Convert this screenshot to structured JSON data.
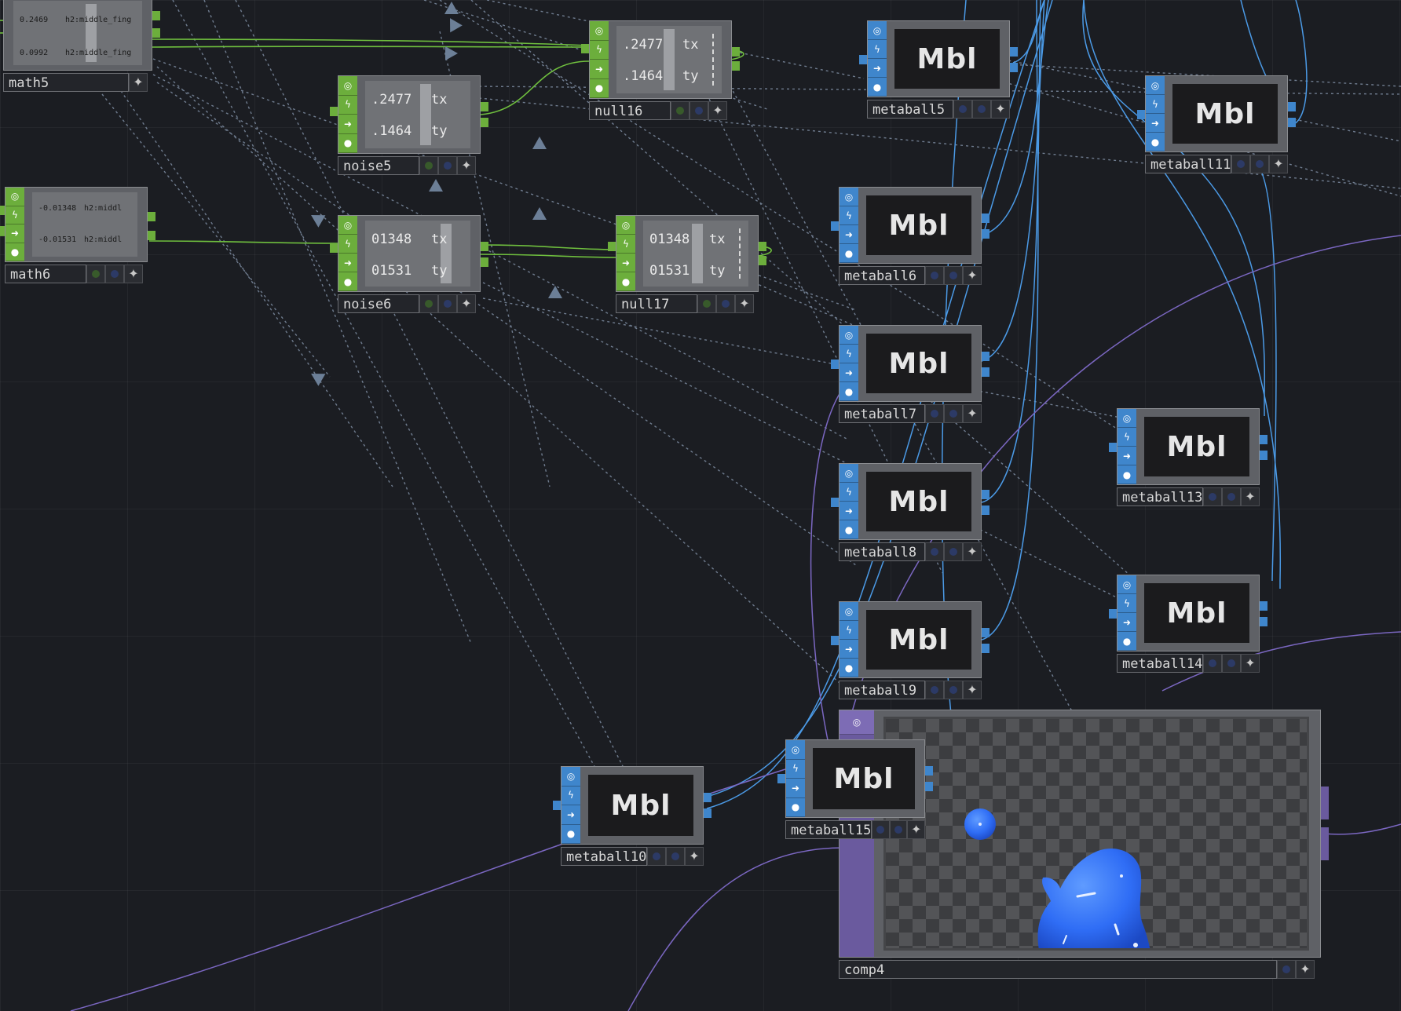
{
  "nodes": {
    "math5": {
      "label": "math5",
      "rows": [
        {
          "value": "0.2469",
          "name": "h2:middle_fing"
        },
        {
          "value": "0.0992",
          "name": "h2:middle_fing"
        }
      ]
    },
    "math6": {
      "label": "math6",
      "rows": [
        {
          "value": "-0.01348",
          "name": "h2:middl"
        },
        {
          "value": "-0.01531",
          "name": "h2:middl"
        }
      ]
    },
    "noise5": {
      "label": "noise5",
      "rows": [
        {
          "value": ".2477",
          "name": "tx"
        },
        {
          "value": ".1464",
          "name": "ty"
        }
      ]
    },
    "noise6": {
      "label": "noise6",
      "rows": [
        {
          "value": "01348",
          "name": "tx"
        },
        {
          "value": "01531",
          "name": "ty"
        }
      ]
    },
    "null16": {
      "label": "null16",
      "rows": [
        {
          "value": ".2477",
          "name": "tx"
        },
        {
          "value": ".1464",
          "name": "ty"
        }
      ]
    },
    "null17": {
      "label": "null17",
      "rows": [
        {
          "value": "01348",
          "name": "tx"
        },
        {
          "value": "01531",
          "name": "ty"
        }
      ]
    },
    "metaball5": {
      "label": "metaball5",
      "viewer_text": "Mbl"
    },
    "metaball6": {
      "label": "metaball6",
      "viewer_text": "Mbl"
    },
    "metaball7": {
      "label": "metaball7",
      "viewer_text": "Mbl"
    },
    "metaball8": {
      "label": "metaball8",
      "viewer_text": "Mbl"
    },
    "metaball9": {
      "label": "metaball9",
      "viewer_text": "Mbl"
    },
    "metaball10": {
      "label": "metaball10",
      "viewer_text": "Mbl"
    },
    "metaball11": {
      "label": "metaball11",
      "viewer_text": "Mbl"
    },
    "metaball13": {
      "label": "metaball13",
      "viewer_text": "Mbl"
    },
    "metaball14": {
      "label": "metaball14",
      "viewer_text": "Mbl"
    },
    "metaball15": {
      "label": "metaball15",
      "viewer_text": "Mbl"
    },
    "comp4": {
      "label": "comp4"
    }
  },
  "colors": {
    "background": "#1b1d22",
    "chop_green": "#6cae3c",
    "top_blue": "#3f86cc",
    "comp_purple": "#6a5a9e",
    "blob_blue": "#2f6df5"
  },
  "icons": [
    "viewer-toggle-icon",
    "cook-icon",
    "bypass-arrow-icon",
    "lock-icon",
    "add-sparkle-icon"
  ]
}
